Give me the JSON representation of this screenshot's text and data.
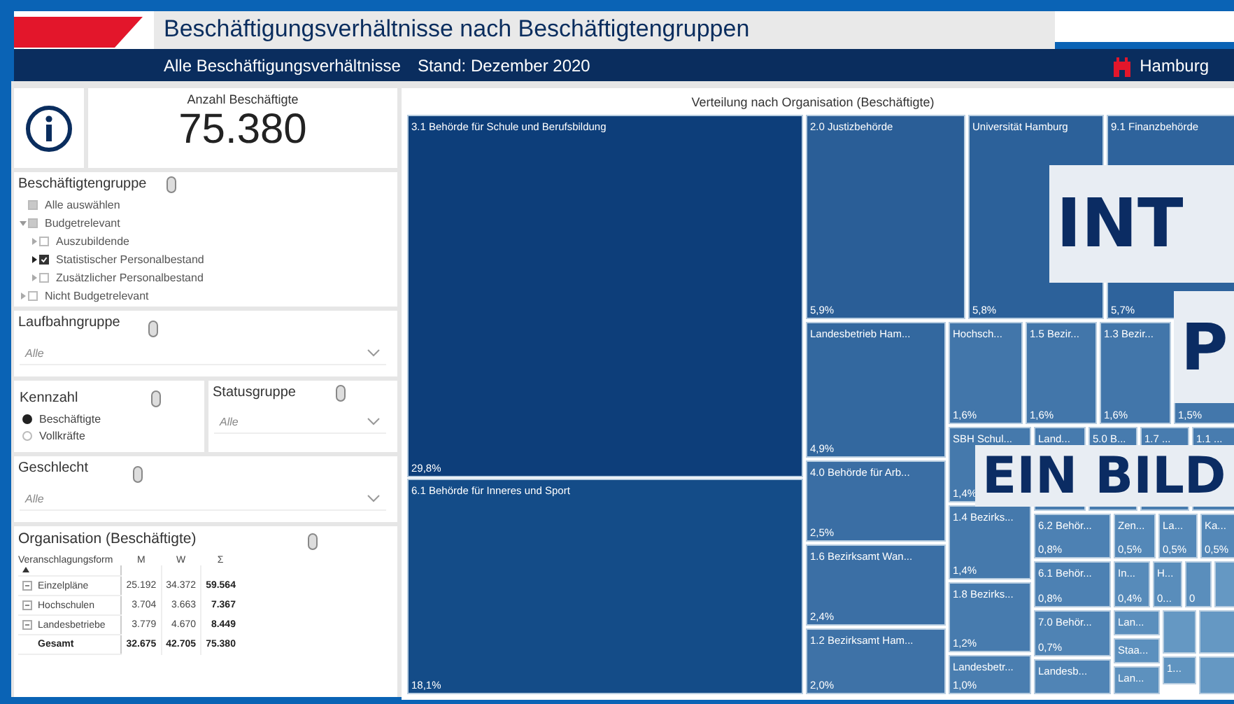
{
  "header": {
    "title": "Beschäftigungsverhältnisse nach Beschäftigtengruppen",
    "subtitle": "Alle Beschäftigungsverhältnisse",
    "date": "Stand: Dezember 2020",
    "brand": "Hamburg"
  },
  "kpi": {
    "label": "Anzahl Beschäftigte",
    "value": "75.380"
  },
  "group_filter": {
    "title": "Beschäftigtengruppe",
    "items": [
      {
        "label": "Alle auswählen",
        "checked": false,
        "partial": true
      },
      {
        "label": "Budgetrelevant",
        "checked": false,
        "partial": true,
        "expanded": true,
        "children": [
          {
            "label": "Auszubildende",
            "checked": false,
            "expanded": false
          },
          {
            "label": "Statistischer Personalbestand",
            "checked": true,
            "expanded": false
          },
          {
            "label": "Zusätzlicher Personalbestand",
            "checked": false,
            "expanded": false
          }
        ]
      },
      {
        "label": "Nicht Budgetrelevant",
        "checked": false,
        "expanded": false
      }
    ]
  },
  "career_filter": {
    "title": "Laufbahngruppe",
    "placeholder": "Alle"
  },
  "metric": {
    "title": "Kennzahl",
    "options": [
      {
        "label": "Beschäftigte",
        "selected": true
      },
      {
        "label": "Vollkräfte",
        "selected": false
      }
    ]
  },
  "status_filter": {
    "title": "Statusgruppe",
    "placeholder": "Alle"
  },
  "gender_filter": {
    "title": "Geschlecht",
    "placeholder": "Alle"
  },
  "org_table": {
    "title": "Organisation (Beschäftigte)",
    "columns": [
      "Veranschlagungsform",
      "M",
      "W",
      "Σ"
    ],
    "rows": [
      {
        "kind": "group",
        "label": "Einzelpläne",
        "m": "25.192",
        "w": "34.372",
        "sum": "59.564"
      },
      {
        "kind": "group",
        "label": "Hochschulen",
        "m": "3.704",
        "w": "3.663",
        "sum": "7.367"
      },
      {
        "kind": "group",
        "label": "Landesbetriebe",
        "m": "3.779",
        "w": "4.670",
        "sum": "8.449"
      },
      {
        "kind": "total",
        "label": "Gesamt",
        "m": "32.675",
        "w": "42.705",
        "sum": "75.380"
      }
    ]
  },
  "treemap": {
    "title": "Verteilung nach Organisation (Beschäftigte)",
    "tiles": [
      {
        "label": "3.1 Behörde für Schule und Berufsbildung",
        "share": "29,8%",
        "color": "#0d3e7a"
      },
      {
        "label": "6.1 Behörde für Inneres und Sport",
        "share": "18,1%",
        "color": "#144c88"
      },
      {
        "label": "2.0 Justizbehörde",
        "share": "5,9%",
        "color": "#2a5e97"
      },
      {
        "label": "Universität Hamburg",
        "share": "5,8%",
        "color": "#2c619a"
      },
      {
        "label": "9.1 Finanzbehörde",
        "share": "5,7%",
        "color": "#2e639c"
      },
      {
        "label": "Landesbetrieb Ham...",
        "share": "4,9%",
        "color": "#33689f"
      },
      {
        "label": "4.0 Behörde für Arb...",
        "share": "2,5%",
        "color": "#3a6ea4"
      },
      {
        "label": "1.6 Bezirksamt Wan...",
        "share": "2,4%",
        "color": "#3b6fa5"
      },
      {
        "label": "1.2 Bezirksamt Ham...",
        "share": "2,0%",
        "color": "#3e72a7"
      },
      {
        "label": "Hochsch...",
        "share": "1,6%",
        "color": "#4276aa"
      },
      {
        "label": "1.5 Bezir...",
        "share": "1,6%",
        "color": "#4276aa"
      },
      {
        "label": "1.3 Bezir...",
        "share": "1,6%",
        "color": "#4276aa"
      },
      {
        "share": "1,5%",
        "color": "#4377ab"
      },
      {
        "label": "SBH Schul...",
        "share": "1,4%",
        "color": "#4579ac"
      },
      {
        "label": "Land...",
        "color": "#477bae"
      },
      {
        "label": "5.0 B...",
        "color": "#477bae"
      },
      {
        "label": "1.7 ...",
        "color": "#487caf"
      },
      {
        "label": "1.1 ...",
        "color": "#487caf"
      },
      {
        "label": "1.4 Bezirks...",
        "share": "1,4%",
        "color": "#4579ac"
      },
      {
        "label": "1.8 Bezirks...",
        "share": "1,2%",
        "color": "#477bae"
      },
      {
        "label": "Landesbetr...",
        "share": "1,0%",
        "color": "#4a7eb0"
      },
      {
        "label": "6.2 Behör...",
        "share": "0,8%",
        "color": "#4d81b3"
      },
      {
        "label": "6.1 Behör...",
        "share": "0,8%",
        "color": "#4d81b3"
      },
      {
        "label": "7.0 Behör...",
        "share": "0,7%",
        "color": "#4f83b4"
      },
      {
        "label": "Landesb...",
        "color": "#5084b5"
      },
      {
        "label": "Zen...",
        "share": "0,5%",
        "color": "#5488b8"
      },
      {
        "label": "La...",
        "share": "0,5%",
        "color": "#5488b8"
      },
      {
        "label": "Ka...",
        "share": "0,5%",
        "color": "#5488b8"
      },
      {
        "label": "In...",
        "share": "0,4%",
        "color": "#578bba"
      },
      {
        "label": "H...",
        "share": "0...",
        "color": "#598dbb"
      },
      {
        "share": "0",
        "color": "#5a8ebc"
      },
      {
        "label": "Lan...",
        "color": "#5b8fbd"
      },
      {
        "label": "Staa...",
        "color": "#5c90be"
      },
      {
        "label": "Lan...",
        "color": "#5d91be"
      },
      {
        "label": "1...",
        "color": "#6094c0"
      }
    ]
  },
  "overlay": [
    {
      "text": "INT"
    },
    {
      "text": "P"
    },
    {
      "text": "EIN BILD"
    }
  ]
}
